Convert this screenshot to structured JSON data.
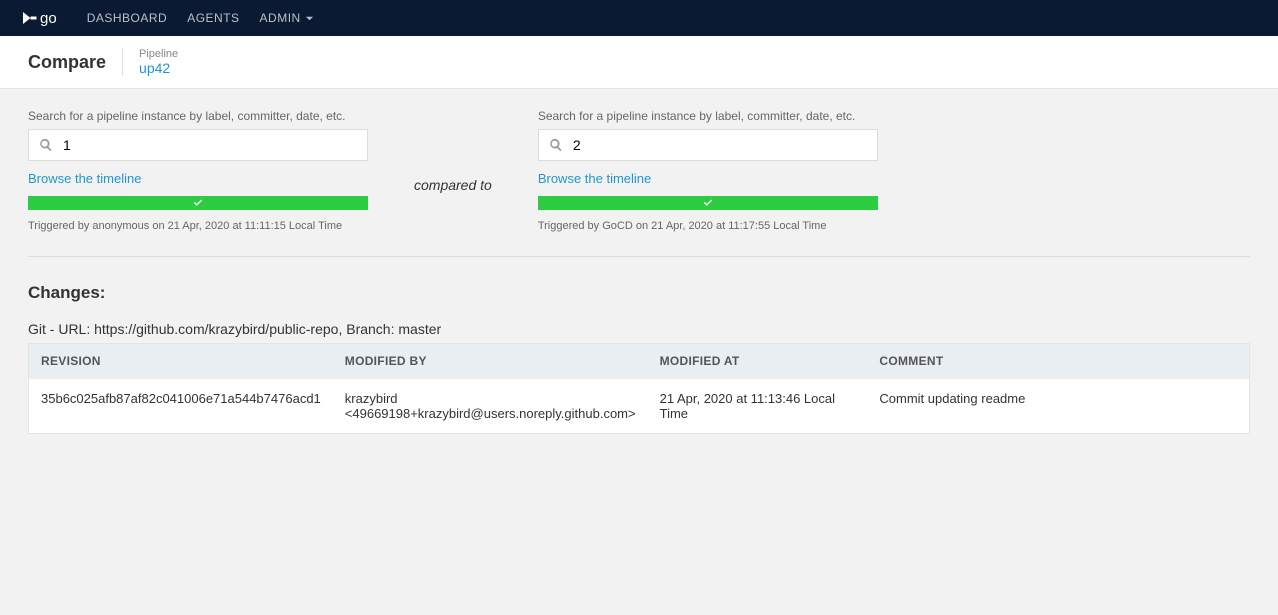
{
  "nav": {
    "dashboard": "DASHBOARD",
    "agents": "AGENTS",
    "admin": "ADMIN"
  },
  "logo_text": "go",
  "header": {
    "title": "Compare",
    "meta_label": "Pipeline",
    "meta_value": "up42"
  },
  "compare": {
    "search_label": "Search for a pipeline instance by label, committer, date, etc.",
    "browse_label": "Browse the timeline",
    "mid_label": "compared to",
    "left": {
      "value": "1",
      "triggered": "Triggered by anonymous on 21 Apr, 2020 at 11:11:15 Local Time"
    },
    "right": {
      "value": "2",
      "triggered": "Triggered by GoCD on 21 Apr, 2020 at 11:17:55 Local Time"
    }
  },
  "changes": {
    "title": "Changes:",
    "repo_line": "Git - URL: https://github.com/krazybird/public-repo, Branch: master",
    "headers": {
      "revision": "REVISION",
      "modified_by": "MODIFIED BY",
      "modified_at": "MODIFIED AT",
      "comment": "COMMENT"
    },
    "row": {
      "revision": "35b6c025afb87af82c041006e71a544b7476acd1",
      "modified_by": "krazybird <49669198+krazybird@users.noreply.github.com>",
      "modified_at": "21 Apr, 2020 at 11:13:46 Local Time",
      "comment": "Commit updating readme"
    }
  }
}
